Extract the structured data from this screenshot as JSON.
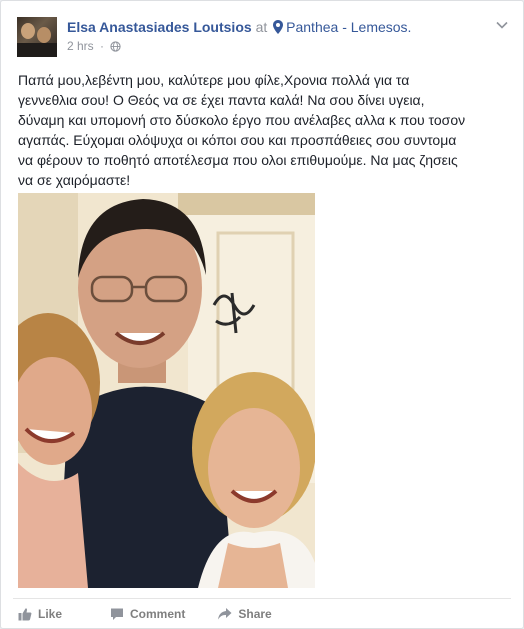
{
  "post": {
    "author": "Elsa Anastasiades Loutsios",
    "at_word": "at",
    "location": "Panthea - Lemesos.",
    "time": "2 hrs",
    "separator": "·",
    "text_lines": [
      "Παπά μου,λεβέντη μου, καλύτερε μου φίλε,Χρονια πολλά για τα",
      "γεννεθλια σου! Ο Θεός να σε έχει παντα καλά! Να σου δίνει υγεια,",
      "δύναμη και υπομονή στο δύσκολο έργο που ανέλαβες αλλα κ που τοσον",
      "αγαπάς. Εύχομαι ολόψυχα οι κόποι σου και προσπάθειες σου συντομα",
      "να φέρουν το ποθητό αποτέλεσμα που ολοι επιθυμούμε. Να μας ζησεις",
      "να σε χαιρόμαστε!"
    ]
  },
  "actions": {
    "like": "Like",
    "comment": "Comment",
    "share": "Share"
  },
  "icons": {
    "location": "map-pin-icon",
    "privacy": "globe-icon",
    "menu": "chevron-down-icon",
    "like": "thumbs-up-icon",
    "comment": "speech-bubble-icon",
    "share": "share-arrow-icon"
  },
  "colors": {
    "link": "#365899",
    "meta": "#90949c",
    "action": "#7f7f7f"
  }
}
